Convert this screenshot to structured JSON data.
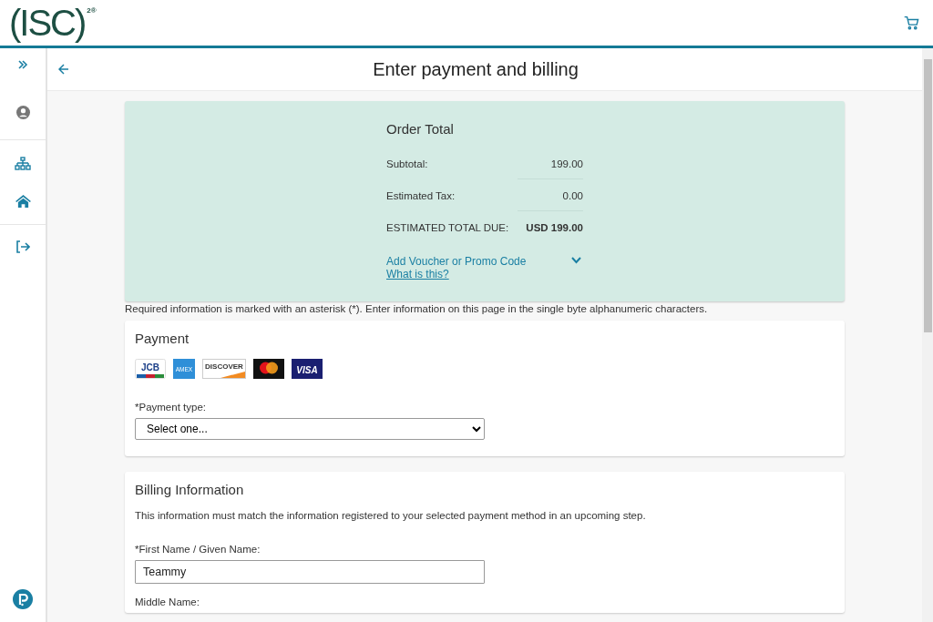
{
  "header": {
    "logo": "(ISC)",
    "logo_sup": "2®"
  },
  "page": {
    "title": "Enter payment and billing"
  },
  "order": {
    "title": "Order Total",
    "rows": [
      {
        "label": "Subtotal:",
        "value": "199.00",
        "kind": "normal"
      },
      {
        "label": "Estimated Tax:",
        "value": "0.00",
        "kind": "normal"
      },
      {
        "label": "ESTIMATED TOTAL DUE:",
        "value": "USD 199.00",
        "kind": "total"
      }
    ],
    "promo": {
      "label": "Add Voucher or Promo Code",
      "expanded": false,
      "help_link": "What is this?"
    }
  },
  "notice": "Required information is marked with an asterisk (*). Enter information on this page in the single byte alphanumeric characters.",
  "payment": {
    "title": "Payment",
    "cards": [
      {
        "kind": "jcb",
        "label": "JCB"
      },
      {
        "kind": "amex",
        "label": "AMEX"
      },
      {
        "kind": "discover",
        "label": "DISCOVER"
      },
      {
        "kind": "mastercard"
      },
      {
        "kind": "visa",
        "label": "VISA"
      }
    ],
    "type_label": "*Payment type:",
    "type_value": "Select one..."
  },
  "billing": {
    "title": "Billing Information",
    "description": "This information must match the information registered to your selected payment method in an upcoming step.",
    "fields": [
      {
        "label": "*First Name / Given Name:",
        "value": "Teammy"
      },
      {
        "label": "Middle Name:"
      }
    ]
  }
}
